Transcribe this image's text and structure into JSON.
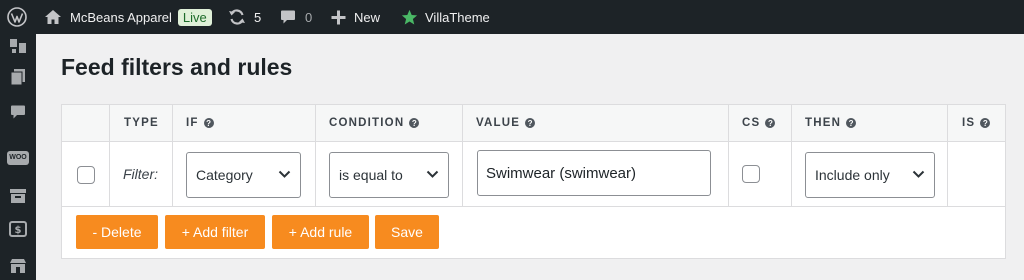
{
  "adminbar": {
    "site_name": "McBeans Apparel",
    "live_badge": "Live",
    "updates_count": "5",
    "comments_count": "0",
    "new_label": "New",
    "villatheme_label": "VillaTheme",
    "accent_color": "#4ab866"
  },
  "sidemenu": {
    "woo_label": "WOO"
  },
  "page": {
    "title": "Feed filters and rules"
  },
  "table": {
    "headers": {
      "type": "TYPE",
      "if": "IF",
      "condition": "CONDITION",
      "value": "VALUE",
      "cs": "CS",
      "then": "THEN",
      "is": "IS"
    },
    "help_glyph": "?",
    "row": {
      "type_label": "Filter:",
      "if_value": "Category",
      "condition_value": "is equal to",
      "value": "Swimwear (swimwear)",
      "cs_checked": false,
      "then_value": "Include only"
    }
  },
  "actions": {
    "delete_label": "- Delete",
    "add_filter_label": "+ Add filter",
    "add_rule_label": "+ Add rule",
    "save_label": "Save",
    "button_color": "#f78b1f"
  }
}
